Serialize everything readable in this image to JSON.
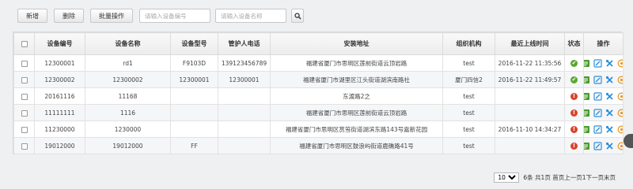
{
  "toolbar": {
    "add_label": "新增",
    "delete_label": "删除",
    "batch_label": "批量操作",
    "device_no_placeholder": "请输入设备编号",
    "device_name_placeholder": "请输入设备名称"
  },
  "table": {
    "headers": [
      "设备编号",
      "设备名称",
      "设备型号",
      "管护人电话",
      "安装地址",
      "组织机构",
      "最近上线时间",
      "状态",
      "操作"
    ],
    "rows": [
      {
        "no": "12300001",
        "name": "rd1",
        "model": "F9103D",
        "phone": "139123456789",
        "address": "福建省厦门市思明区莲前街道云顶岩路",
        "org": "test",
        "time": "2016-11-22 11:35:56",
        "status": "online"
      },
      {
        "no": "12300002",
        "name": "12300002",
        "model": "12300001",
        "phone": "12300001",
        "address": "福建省厦门市湖里区江头街道湖滨南路社",
        "org": "厦门四信2",
        "time": "2016-11-22 11:49:57",
        "status": "online"
      },
      {
        "no": "20161116",
        "name": "11168",
        "model": "",
        "phone": "",
        "address": "东渡路2之",
        "org": "test",
        "time": "",
        "status": "offline"
      },
      {
        "no": "11111111",
        "name": "1116",
        "model": "",
        "phone": "",
        "address": "福建省厦门市思明区莲前街道云顶岩路",
        "org": "test",
        "time": "",
        "status": "offline"
      },
      {
        "no": "11230000",
        "name": "1230000",
        "model": "",
        "phone": "",
        "address": "福建省厦门市思明区筼筜街道湖滨东路143号嘉新花园",
        "org": "test",
        "time": "2016-11-10 14:34:27",
        "status": "offline"
      },
      {
        "no": "19012000",
        "name": "19012000",
        "model": "FF",
        "phone": "",
        "address": "福建省厦门市思明区鼓浪屿街道鹿礁路41号",
        "org": "test",
        "time": "",
        "status": "offline"
      }
    ]
  },
  "pagination": {
    "page_size": "10",
    "summary": "6条 共1页 首页上一页1下一页末页"
  },
  "colors": {
    "status_online": "#5aa830",
    "status_offline": "#d9432b",
    "op_edit": "#4a9a2c",
    "op_view": "#2f8fd8",
    "op_settings": "#2f8fd8",
    "op_more": "#e89a2a"
  },
  "icons": {
    "ok": "✔",
    "err": "!",
    "search": "search-icon",
    "edit": "edit-icon",
    "view": "view-icon",
    "settings": "settings-icon",
    "more": "more-icon"
  }
}
